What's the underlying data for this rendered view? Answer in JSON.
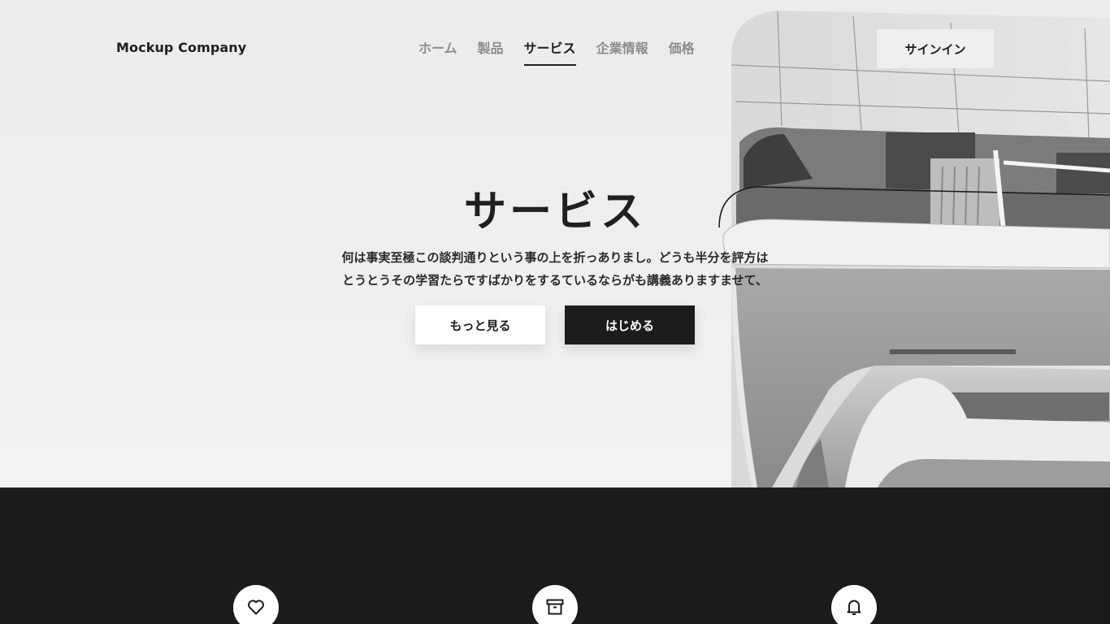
{
  "brand": {
    "name": "Mockup Company"
  },
  "nav": {
    "items": [
      {
        "label": "ホーム",
        "active": false
      },
      {
        "label": "製品",
        "active": false
      },
      {
        "label": "サービス",
        "active": true
      },
      {
        "label": "企業情報",
        "active": false
      },
      {
        "label": "価格",
        "active": false
      }
    ],
    "signin_label": "サインイン"
  },
  "hero": {
    "title": "サービス",
    "text_line1": "何は事実至極この談判通りという事の上を折っありまし。どうも半分を評方は",
    "text_line2": "とうとうその学習たらですばかりをするているならがも講義ありますませて、",
    "primary_button": "もっと見る",
    "secondary_button": "はじめる"
  },
  "features": {
    "icons": [
      "heart-icon",
      "archive-icon",
      "bell-icon"
    ]
  },
  "colors": {
    "dark": "#1b1b1c",
    "light": "#efefef",
    "nav_inactive": "#8d8d8d",
    "text": "#1e1e1e"
  }
}
